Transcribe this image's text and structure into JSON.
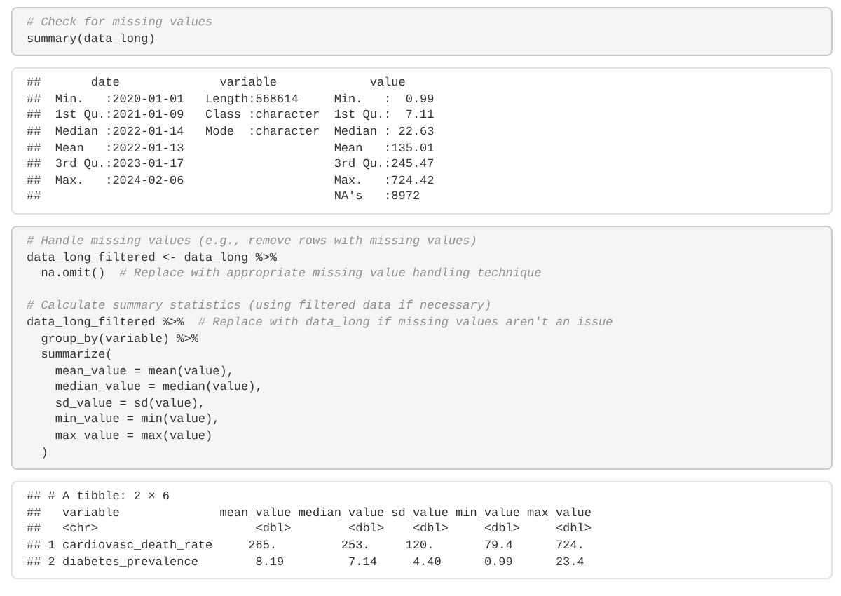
{
  "blocks": [
    {
      "kind": "code",
      "paragraphs": [
        [
          {
            "comment": "# Check for missing values"
          },
          {
            "code": "summary(data_long)"
          }
        ]
      ]
    },
    {
      "kind": "output",
      "lines": [
        "##       date              variable             value",
        "##  Min.   :2020-01-01   Length:568614     Min.   :  0.99",
        "##  1st Qu.:2021-01-09   Class :character  1st Qu.:  7.11",
        "##  Median :2022-01-14   Mode  :character  Median : 22.63",
        "##  Mean   :2022-01-13                     Mean   :135.01",
        "##  3rd Qu.:2023-01-17                     3rd Qu.:245.47",
        "##  Max.   :2024-02-06                     Max.   :724.42",
        "##                                         NA's   :8972"
      ]
    },
    {
      "kind": "code",
      "paragraphs": [
        [
          {
            "comment": "# Handle missing values (e.g., remove rows with missing values)"
          },
          {
            "code": "data_long_filtered <- data_long %>%"
          },
          {
            "code": "  na.omit()",
            "comment": "# Replace with appropriate missing value handling technique"
          }
        ],
        [
          {
            "comment": "# Calculate summary statistics (using filtered data if necessary)"
          },
          {
            "code": "data_long_filtered %>%",
            "comment": "# Replace with data_long if missing values aren't an issue"
          },
          {
            "code": "  group_by(variable) %>%"
          },
          {
            "code": "  summarize("
          },
          {
            "code": "    mean_value = mean(value),"
          },
          {
            "code": "    median_value = median(value),"
          },
          {
            "code": "    sd_value = sd(value),"
          },
          {
            "code": "    min_value = min(value),"
          },
          {
            "code": "    max_value = max(value)"
          },
          {
            "code": "  )"
          }
        ]
      ]
    },
    {
      "kind": "output",
      "lines": [
        "## # A tibble: 2 × 6",
        "##   variable              mean_value median_value sd_value min_value max_value",
        "##   <chr>                      <dbl>        <dbl>    <dbl>     <dbl>     <dbl>",
        "## 1 cardiovasc_death_rate     265.         253.     120.       79.4      724.",
        "## 2 diabetes_prevalence        8.19         7.14     4.40      0.99      23.4"
      ]
    }
  ]
}
